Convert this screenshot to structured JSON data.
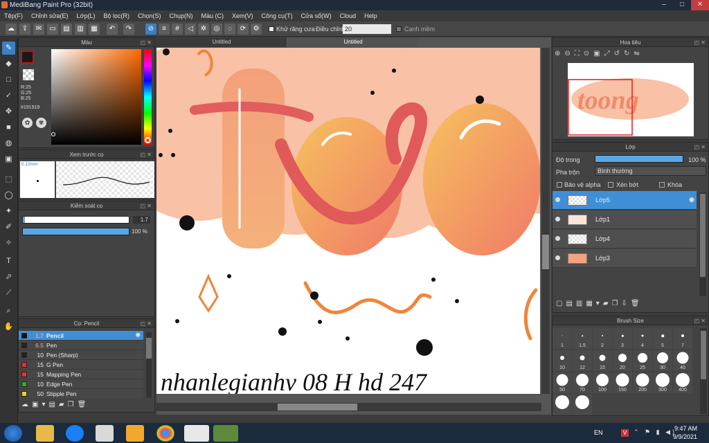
{
  "window": {
    "title": "MediBang Paint Pro (32bit)"
  },
  "menu": [
    "Tệp(F)",
    "Chỉnh sửa(E)",
    "Lớp(L)",
    "Bộ lọc(R)",
    "Chọn(S)",
    "Chụp(N)",
    "Màu (C)",
    "Xem(V)",
    "Công cụ(T)",
    "Cửa sổ(W)",
    "Cloud",
    "Help"
  ],
  "toolbar": {
    "antialias_label": "Khử răng cưa",
    "adjust_label": "Điều chỉnh",
    "adjust_value": "20",
    "edge_label": "Cạnh mềm"
  },
  "color_panel": {
    "title": "Màu",
    "rgb": {
      "r": "R:25",
      "g": "G:25",
      "b": "B:25"
    },
    "hex": "#191919",
    "fg_color": "#191919",
    "accent": "#cc1111"
  },
  "brush_preview": {
    "title": "Xem trước cọ",
    "size": "0.12mm"
  },
  "brush_control": {
    "title": "Kiểm soát cọ",
    "size_value": "1.7",
    "opacity_value": "100 %"
  },
  "canvas": {
    "tabs": [
      "Untitled",
      "Untitled"
    ],
    "drawn_text": "toong",
    "signature": "nhanlegianhv 08 H hd 247"
  },
  "brush_panel": {
    "title": "Cọ: Pencil",
    "items": [
      {
        "size": "1.7",
        "name": "Pencil",
        "color": "#111111",
        "active": true
      },
      {
        "size": "6.5",
        "name": "Pen",
        "color": "#222222"
      },
      {
        "size": "10",
        "name": "Pen (Sharp)",
        "color": "#222222"
      },
      {
        "size": "15",
        "name": "G Pen",
        "color": "#e63030"
      },
      {
        "size": "15",
        "name": "Mapping Pen",
        "color": "#e63030"
      },
      {
        "size": "10",
        "name": "Edge Pen",
        "color": "#2bb02b"
      },
      {
        "size": "50",
        "name": "Stipple Pen",
        "color": "#f0d020"
      }
    ]
  },
  "navigator": {
    "title": "Hoa tiêu"
  },
  "layer_panel": {
    "title": "Lớp",
    "opacity_label": "Độ trong",
    "opacity_value": "100 %",
    "blend_label": "Pha trộn",
    "blend_value": "Bình thường",
    "protect_alpha": "Bảo vệ alpha",
    "clip": "Xén bớt",
    "lock": "Khóa",
    "layers": [
      {
        "name": "Lớp5",
        "active": true
      },
      {
        "name": "Lớp1"
      },
      {
        "name": "Lớp4"
      },
      {
        "name": "Lớp3"
      }
    ]
  },
  "brush_size": {
    "title": "Brush Size",
    "sizes": [
      "1",
      "1.5",
      "2",
      "3",
      "4",
      "5",
      "7",
      "10",
      "12",
      "15",
      "20",
      "25",
      "30",
      "40",
      "50",
      "70",
      "100",
      "150",
      "200",
      "300",
      "400",
      "",
      ""
    ]
  },
  "taskbar": {
    "lang": "EN",
    "time": "9:47 AM",
    "date": "9/9/2021"
  }
}
